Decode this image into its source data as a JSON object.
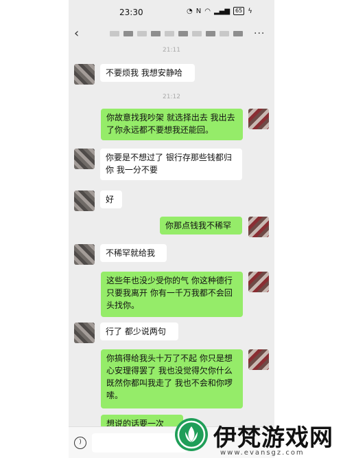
{
  "status": {
    "time": "23:30",
    "battery": "65"
  },
  "chat": {
    "timestamps": [
      "21:11",
      "21:12"
    ],
    "messages": [
      {
        "side": "in",
        "text": "不要烦我 我想安静哈"
      },
      {
        "side": "out",
        "text": "你故意找我吵架 就选择出去 我出去了你永远都不要想我还能回。"
      },
      {
        "side": "in",
        "text": "你要是不想过了 银行存那些钱都归你 我一分不要"
      },
      {
        "side": "in",
        "text": "好"
      },
      {
        "side": "out",
        "text": "你那点钱我不稀罕"
      },
      {
        "side": "in",
        "text": "不稀罕就给我"
      },
      {
        "side": "out",
        "text": "这些年也没少受你的气 你这种德行 只要我离开 你有一千万我都不会回头找你。"
      },
      {
        "side": "in",
        "text": "行了 都少说两句"
      },
      {
        "side": "out",
        "text": "你搞得给我头十万了不起 你只是想心安理得罢了 我也没觉得欠你什么 既然你都叫我走了 我也不会和你啰嗦。"
      },
      {
        "side": "out",
        "text": "想说的话要一次"
      }
    ]
  },
  "watermark": {
    "brand": "伊梵游戏网",
    "url": "www.evansgz.com",
    "logo_color": "#1f9e58"
  }
}
